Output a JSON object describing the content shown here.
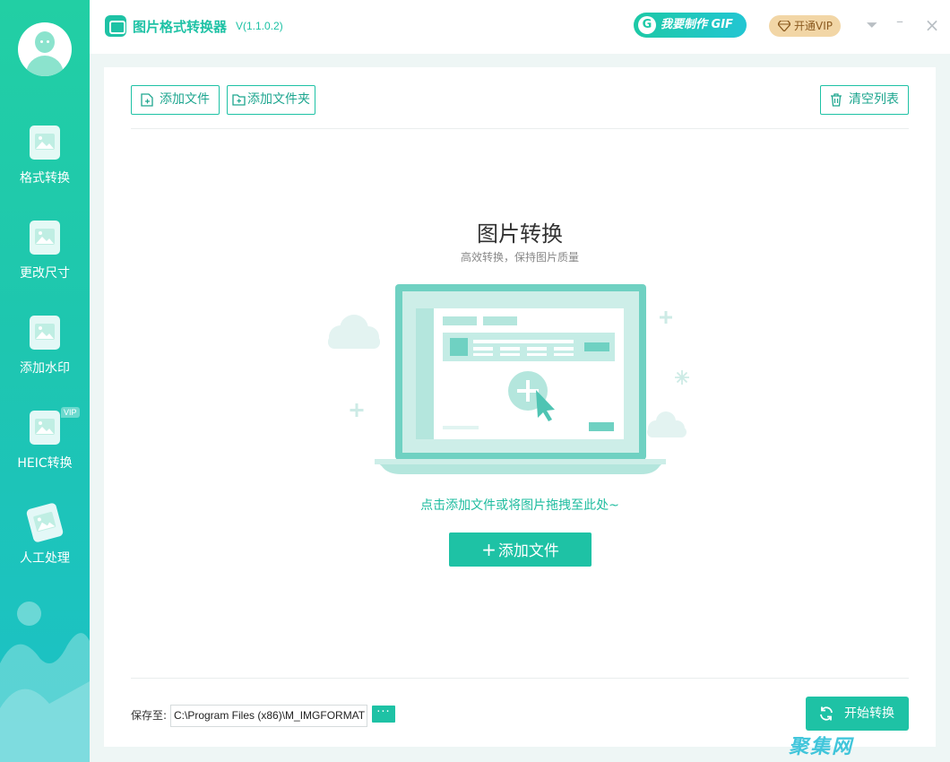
{
  "app": {
    "title": "图片格式转换器",
    "version": "V(1.1.0.2)",
    "gif_button": "我要制作 GIF",
    "gif_badge": "G",
    "vip_button": "开通VIP"
  },
  "window_controls": {
    "menu": "⏷",
    "minimize": "–",
    "close": "×"
  },
  "sidebar": {
    "items": [
      {
        "label": "格式转换",
        "icon": "image-convert-icon"
      },
      {
        "label": "更改尺寸",
        "icon": "image-resize-icon"
      },
      {
        "label": "添加水印",
        "icon": "image-watermark-icon"
      },
      {
        "label": "HEIC转换",
        "icon": "heic-icon",
        "badge": "VIP"
      },
      {
        "label": "人工处理",
        "icon": "manual-process-icon"
      }
    ]
  },
  "toolbar": {
    "add_file": "添加文件",
    "add_folder": "添加文件夹",
    "clear_list": "清空列表"
  },
  "empty_state": {
    "title": "图片转换",
    "subtitle": "高效转换，保持图片质量",
    "hint": "点击添加文件或将图片拖拽至此处~",
    "add_button": "添加文件",
    "add_button_plus": "+"
  },
  "footer": {
    "save_label": "保存至:",
    "save_path": "C:\\Program Files (x86)\\M_IMGFORMAT",
    "browse_label": "···",
    "start_button": "开始转换"
  },
  "watermark": "聚集网",
  "colors": {
    "accent": "#1ec2a5",
    "sidebar_top": "#22cfa4",
    "sidebar_bottom": "#1bc1c8",
    "vip_gold": "#f2d6a6"
  }
}
